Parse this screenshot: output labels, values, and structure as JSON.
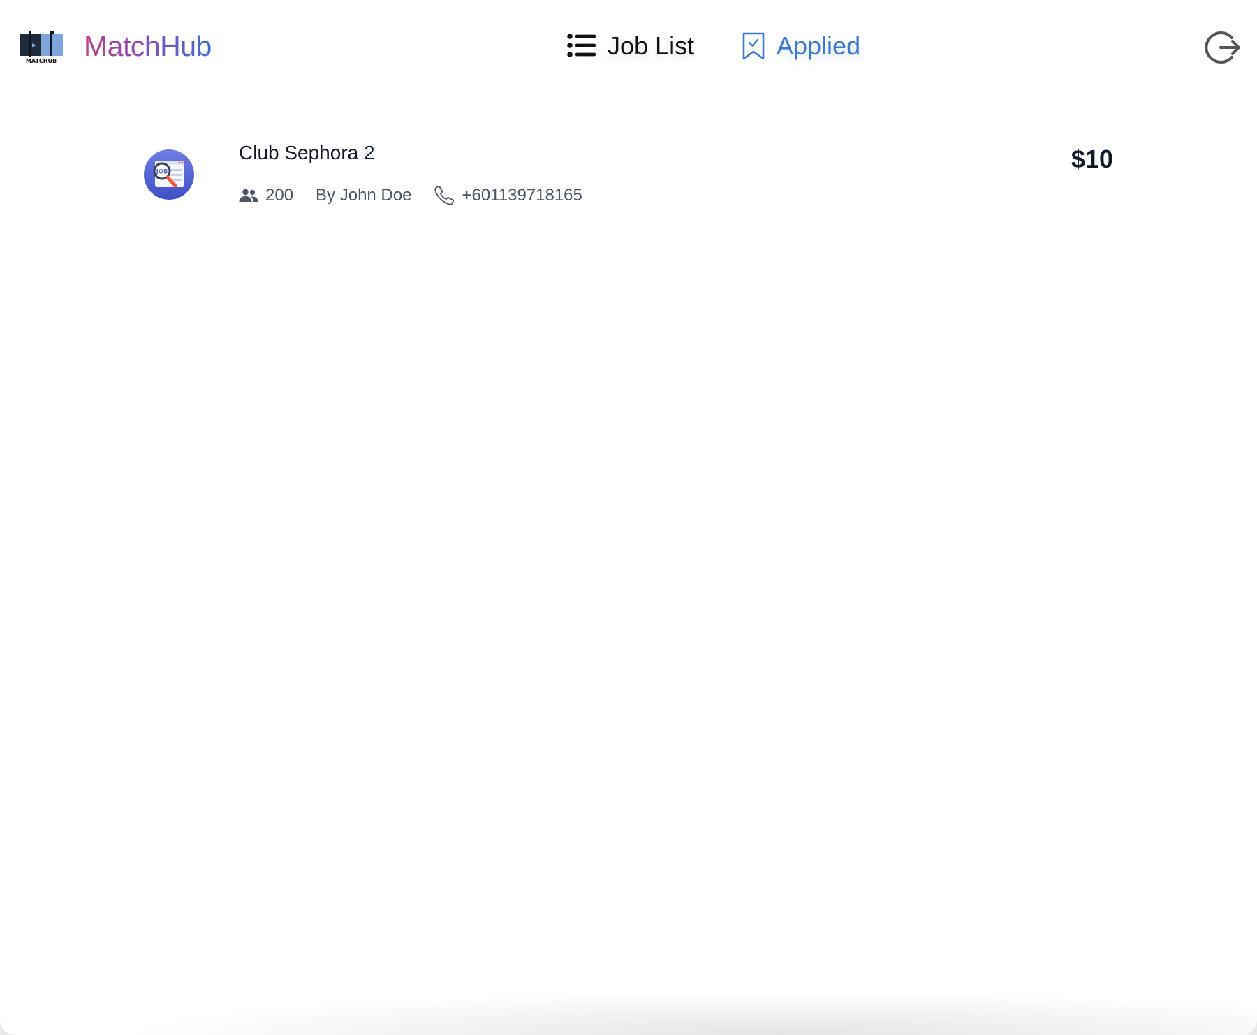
{
  "header": {
    "logo_caption": "MATCHUB",
    "brand": "MatchHub",
    "nav": {
      "job_list": {
        "label": "Job List",
        "icon": "list-icon"
      },
      "applied": {
        "label": "Applied",
        "icon": "bookmark-check-icon",
        "active": true
      }
    },
    "logout_icon": "logout-icon"
  },
  "colors": {
    "brand_gradient_start": "#c23f86",
    "brand_gradient_end": "#3b6fd6",
    "accent": "#3c78d8",
    "text_primary": "#111827",
    "text_secondary": "#4b5563"
  },
  "jobs": [
    {
      "title": "Club Sephora 2",
      "avatar_text": "JOB",
      "applicants": "200",
      "employer": "By John Doe",
      "phone": "+601139718165",
      "pay": "$10",
      "icons": {
        "applicants": "people-icon",
        "phone": "phone-icon"
      }
    }
  ]
}
